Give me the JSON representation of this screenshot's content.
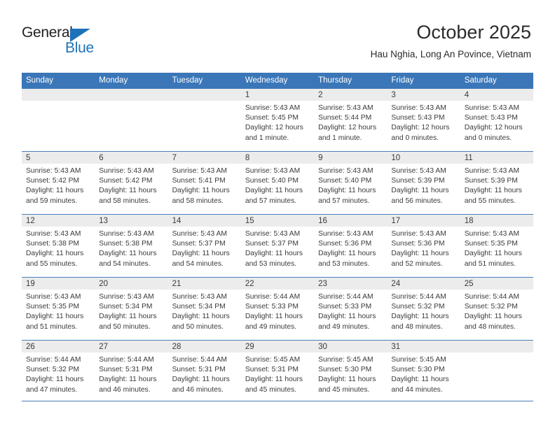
{
  "brand": {
    "name_top": "General",
    "name_bottom": "Blue",
    "color_primary": "#1e72b8",
    "color_text": "#231f20",
    "triangle_icon": "triangle-icon"
  },
  "header": {
    "title": "October 2025",
    "subtitle": "Hau Nghia, Long An Povince, Vietnam"
  },
  "calendar": {
    "header_bg": "#3b77b8",
    "header_text_color": "#ffffff",
    "daynum_band_bg": "#ececec",
    "weekdays": [
      "Sunday",
      "Monday",
      "Tuesday",
      "Wednesday",
      "Thursday",
      "Friday",
      "Saturday"
    ],
    "weeks": [
      [
        {
          "day": "",
          "sunrise": "",
          "sunset": "",
          "daylight": "",
          "daylight2": ""
        },
        {
          "day": "",
          "sunrise": "",
          "sunset": "",
          "daylight": "",
          "daylight2": ""
        },
        {
          "day": "",
          "sunrise": "",
          "sunset": "",
          "daylight": "",
          "daylight2": ""
        },
        {
          "day": "1",
          "sunrise": "Sunrise: 5:43 AM",
          "sunset": "Sunset: 5:45 PM",
          "daylight": "Daylight: 12 hours",
          "daylight2": "and 1 minute."
        },
        {
          "day": "2",
          "sunrise": "Sunrise: 5:43 AM",
          "sunset": "Sunset: 5:44 PM",
          "daylight": "Daylight: 12 hours",
          "daylight2": "and 1 minute."
        },
        {
          "day": "3",
          "sunrise": "Sunrise: 5:43 AM",
          "sunset": "Sunset: 5:43 PM",
          "daylight": "Daylight: 12 hours",
          "daylight2": "and 0 minutes."
        },
        {
          "day": "4",
          "sunrise": "Sunrise: 5:43 AM",
          "sunset": "Sunset: 5:43 PM",
          "daylight": "Daylight: 12 hours",
          "daylight2": "and 0 minutes."
        }
      ],
      [
        {
          "day": "5",
          "sunrise": "Sunrise: 5:43 AM",
          "sunset": "Sunset: 5:42 PM",
          "daylight": "Daylight: 11 hours",
          "daylight2": "and 59 minutes."
        },
        {
          "day": "6",
          "sunrise": "Sunrise: 5:43 AM",
          "sunset": "Sunset: 5:42 PM",
          "daylight": "Daylight: 11 hours",
          "daylight2": "and 58 minutes."
        },
        {
          "day": "7",
          "sunrise": "Sunrise: 5:43 AM",
          "sunset": "Sunset: 5:41 PM",
          "daylight": "Daylight: 11 hours",
          "daylight2": "and 58 minutes."
        },
        {
          "day": "8",
          "sunrise": "Sunrise: 5:43 AM",
          "sunset": "Sunset: 5:40 PM",
          "daylight": "Daylight: 11 hours",
          "daylight2": "and 57 minutes."
        },
        {
          "day": "9",
          "sunrise": "Sunrise: 5:43 AM",
          "sunset": "Sunset: 5:40 PM",
          "daylight": "Daylight: 11 hours",
          "daylight2": "and 57 minutes."
        },
        {
          "day": "10",
          "sunrise": "Sunrise: 5:43 AM",
          "sunset": "Sunset: 5:39 PM",
          "daylight": "Daylight: 11 hours",
          "daylight2": "and 56 minutes."
        },
        {
          "day": "11",
          "sunrise": "Sunrise: 5:43 AM",
          "sunset": "Sunset: 5:39 PM",
          "daylight": "Daylight: 11 hours",
          "daylight2": "and 55 minutes."
        }
      ],
      [
        {
          "day": "12",
          "sunrise": "Sunrise: 5:43 AM",
          "sunset": "Sunset: 5:38 PM",
          "daylight": "Daylight: 11 hours",
          "daylight2": "and 55 minutes."
        },
        {
          "day": "13",
          "sunrise": "Sunrise: 5:43 AM",
          "sunset": "Sunset: 5:38 PM",
          "daylight": "Daylight: 11 hours",
          "daylight2": "and 54 minutes."
        },
        {
          "day": "14",
          "sunrise": "Sunrise: 5:43 AM",
          "sunset": "Sunset: 5:37 PM",
          "daylight": "Daylight: 11 hours",
          "daylight2": "and 54 minutes."
        },
        {
          "day": "15",
          "sunrise": "Sunrise: 5:43 AM",
          "sunset": "Sunset: 5:37 PM",
          "daylight": "Daylight: 11 hours",
          "daylight2": "and 53 minutes."
        },
        {
          "day": "16",
          "sunrise": "Sunrise: 5:43 AM",
          "sunset": "Sunset: 5:36 PM",
          "daylight": "Daylight: 11 hours",
          "daylight2": "and 53 minutes."
        },
        {
          "day": "17",
          "sunrise": "Sunrise: 5:43 AM",
          "sunset": "Sunset: 5:36 PM",
          "daylight": "Daylight: 11 hours",
          "daylight2": "and 52 minutes."
        },
        {
          "day": "18",
          "sunrise": "Sunrise: 5:43 AM",
          "sunset": "Sunset: 5:35 PM",
          "daylight": "Daylight: 11 hours",
          "daylight2": "and 51 minutes."
        }
      ],
      [
        {
          "day": "19",
          "sunrise": "Sunrise: 5:43 AM",
          "sunset": "Sunset: 5:35 PM",
          "daylight": "Daylight: 11 hours",
          "daylight2": "and 51 minutes."
        },
        {
          "day": "20",
          "sunrise": "Sunrise: 5:43 AM",
          "sunset": "Sunset: 5:34 PM",
          "daylight": "Daylight: 11 hours",
          "daylight2": "and 50 minutes."
        },
        {
          "day": "21",
          "sunrise": "Sunrise: 5:43 AM",
          "sunset": "Sunset: 5:34 PM",
          "daylight": "Daylight: 11 hours",
          "daylight2": "and 50 minutes."
        },
        {
          "day": "22",
          "sunrise": "Sunrise: 5:44 AM",
          "sunset": "Sunset: 5:33 PM",
          "daylight": "Daylight: 11 hours",
          "daylight2": "and 49 minutes."
        },
        {
          "day": "23",
          "sunrise": "Sunrise: 5:44 AM",
          "sunset": "Sunset: 5:33 PM",
          "daylight": "Daylight: 11 hours",
          "daylight2": "and 49 minutes."
        },
        {
          "day": "24",
          "sunrise": "Sunrise: 5:44 AM",
          "sunset": "Sunset: 5:32 PM",
          "daylight": "Daylight: 11 hours",
          "daylight2": "and 48 minutes."
        },
        {
          "day": "25",
          "sunrise": "Sunrise: 5:44 AM",
          "sunset": "Sunset: 5:32 PM",
          "daylight": "Daylight: 11 hours",
          "daylight2": "and 48 minutes."
        }
      ],
      [
        {
          "day": "26",
          "sunrise": "Sunrise: 5:44 AM",
          "sunset": "Sunset: 5:32 PM",
          "daylight": "Daylight: 11 hours",
          "daylight2": "and 47 minutes."
        },
        {
          "day": "27",
          "sunrise": "Sunrise: 5:44 AM",
          "sunset": "Sunset: 5:31 PM",
          "daylight": "Daylight: 11 hours",
          "daylight2": "and 46 minutes."
        },
        {
          "day": "28",
          "sunrise": "Sunrise: 5:44 AM",
          "sunset": "Sunset: 5:31 PM",
          "daylight": "Daylight: 11 hours",
          "daylight2": "and 46 minutes."
        },
        {
          "day": "29",
          "sunrise": "Sunrise: 5:45 AM",
          "sunset": "Sunset: 5:31 PM",
          "daylight": "Daylight: 11 hours",
          "daylight2": "and 45 minutes."
        },
        {
          "day": "30",
          "sunrise": "Sunrise: 5:45 AM",
          "sunset": "Sunset: 5:30 PM",
          "daylight": "Daylight: 11 hours",
          "daylight2": "and 45 minutes."
        },
        {
          "day": "31",
          "sunrise": "Sunrise: 5:45 AM",
          "sunset": "Sunset: 5:30 PM",
          "daylight": "Daylight: 11 hours",
          "daylight2": "and 44 minutes."
        },
        {
          "day": "",
          "sunrise": "",
          "sunset": "",
          "daylight": "",
          "daylight2": ""
        }
      ]
    ]
  }
}
